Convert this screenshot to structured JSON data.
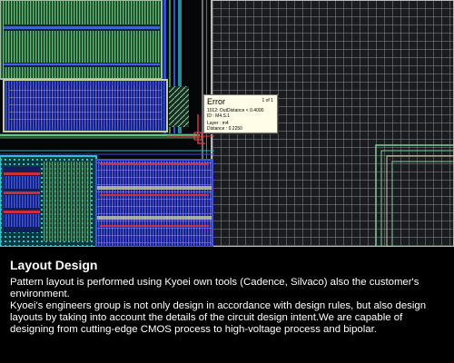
{
  "error_popup": {
    "title": "Error",
    "counter": "1 of 1",
    "line1": "1012: OutDistance < 0.4000",
    "line2": "ID : M4.S.1",
    "line3": "Layer : m4",
    "line4": "Distance : 0.2250"
  },
  "caption": {
    "title": "Layout Design",
    "paragraph1": "Pattern layout is performed using Kyoei own tools (Cadence, Silvaco) also the customer's environment.",
    "paragraph2": "Kyoei's engineers group is not only design in accordance with design rules, but also design layouts by taking into account the details of the circuit design intent.We are capable of designing from cutting-edge CMOS process to high-voltage process and bipolar."
  },
  "colors": {
    "background": "#000000",
    "caption_text": "#ffffff",
    "tooltip_bg": "#fffde7",
    "metal_blue": "#2a3ec9",
    "metal_green": "#48a35a",
    "metal_cyan": "#27b3c4",
    "grid_gray": "#8a8a8a",
    "error_red": "#e0303a"
  }
}
